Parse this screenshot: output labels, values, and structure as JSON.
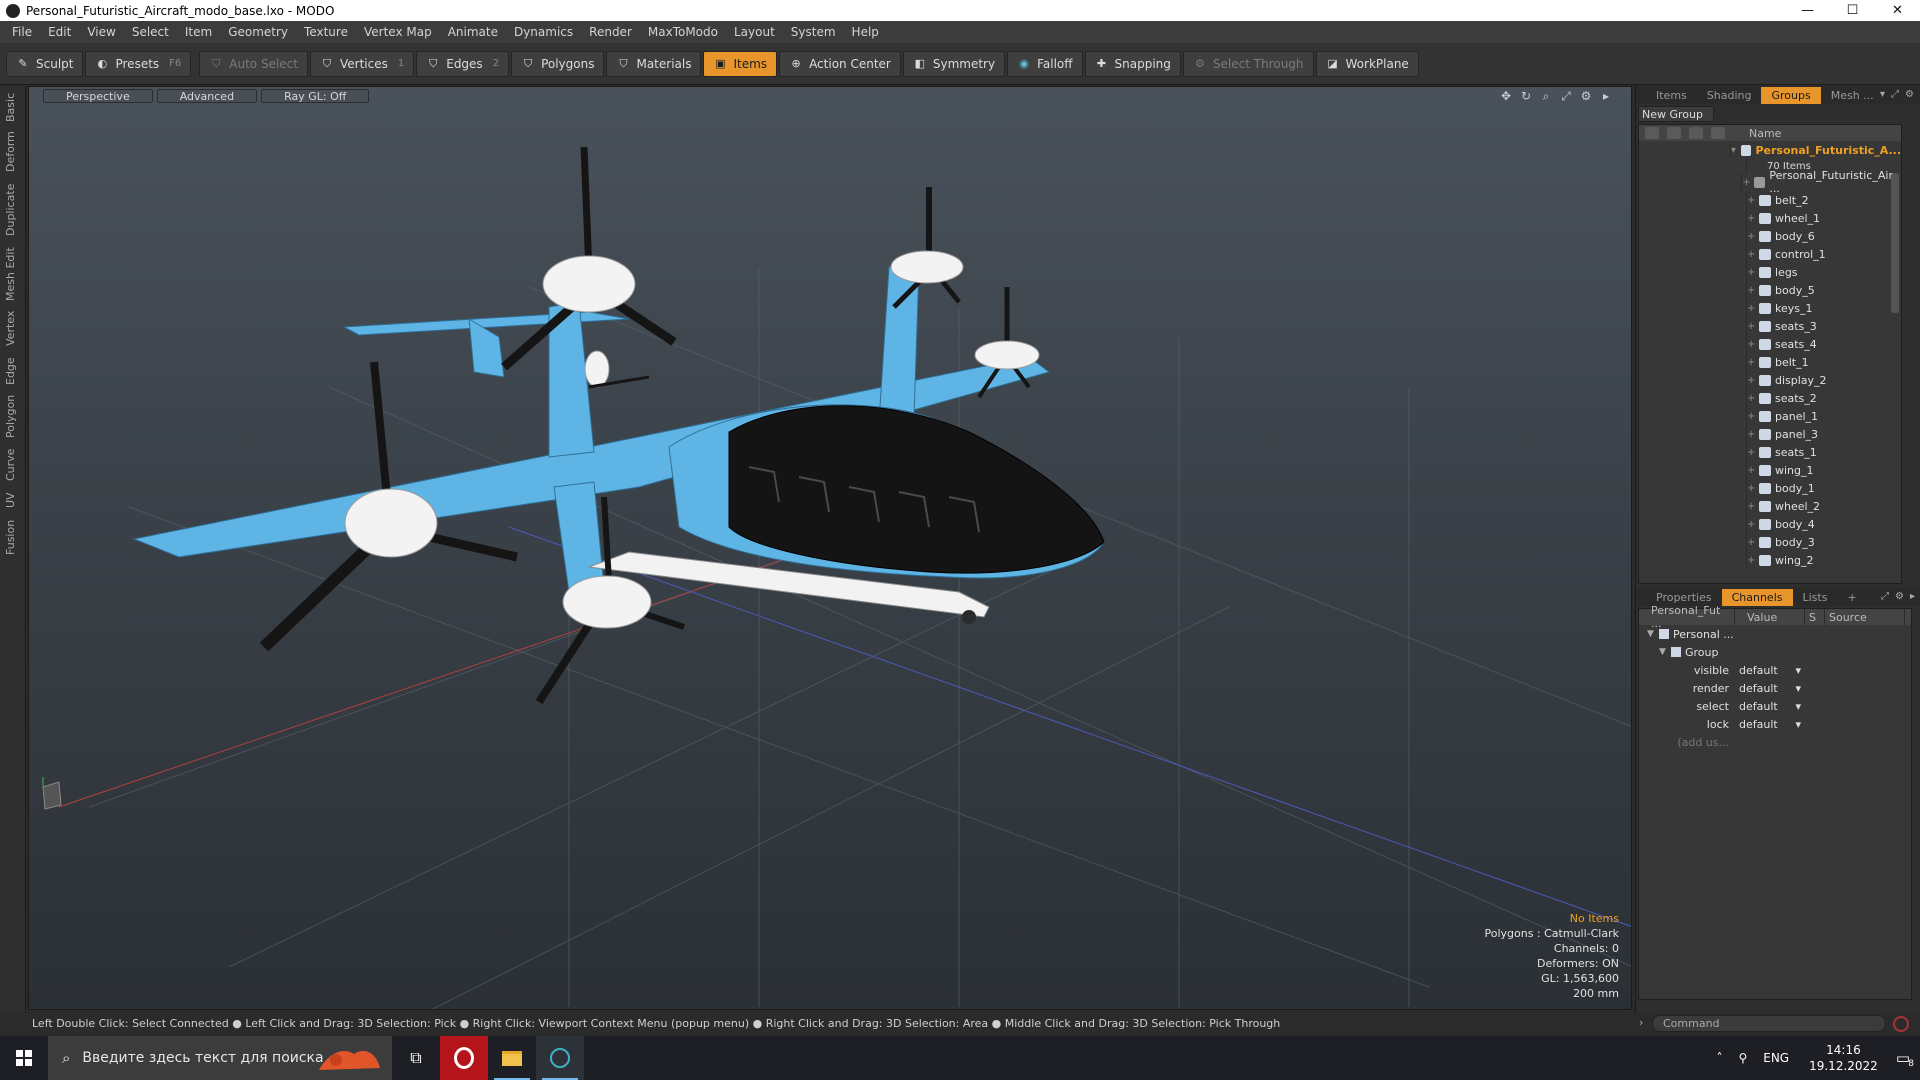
{
  "window": {
    "title": "Personal_Futuristic_Aircraft_modo_base.lxo - MODO",
    "buttons": [
      "—",
      "☐",
      "✕"
    ]
  },
  "menu": [
    "File",
    "Edit",
    "View",
    "Select",
    "Item",
    "Geometry",
    "Texture",
    "Vertex Map",
    "Animate",
    "Dynamics",
    "Render",
    "MaxToModo",
    "Layout",
    "System",
    "Help"
  ],
  "toolbar": {
    "sculpt": "Sculpt",
    "presets": "Presets",
    "presets_key": "F6",
    "auto_select": "Auto Select",
    "vertices": "Vertices",
    "vertices_key": "1",
    "edges": "Edges",
    "edges_key": "2",
    "polygons": "Polygons",
    "materials": "Materials",
    "items": "Items",
    "action_center": "Action Center",
    "symmetry": "Symmetry",
    "falloff": "Falloff",
    "snapping": "Snapping",
    "select_through": "Select Through",
    "workplane": "WorkPlane"
  },
  "left_tabs": [
    "Basic",
    "Deform",
    "Duplicate",
    "Mesh Edit",
    "Vertex",
    "Edge",
    "Polygon",
    "Curve",
    "UV",
    "Fusion"
  ],
  "viewport": {
    "tabs": [
      "Perspective",
      "Advanced",
      "Ray GL: Off"
    ],
    "info": {
      "selection": "No Items",
      "polygons": "Polygons : Catmull-Clark",
      "channels": "Channels: 0",
      "deformers": "Deformers: ON",
      "gl": "GL: 1,563,600",
      "scale": "200 mm"
    }
  },
  "right_panel": {
    "tabs": [
      "Items",
      "Shading",
      "Groups",
      "Mesh ..."
    ],
    "active_tab": "Groups",
    "new_group": "New Group",
    "name_header": "Name",
    "group_name": "Personal_Futuristic_A...",
    "group_count": "70 Items",
    "first_item": "Personal_Futuristic_Air ...",
    "items": [
      "belt_2",
      "wheel_1",
      "body_6",
      "control_1",
      "legs",
      "body_5",
      "keys_1",
      "seats_3",
      "seats_4",
      "belt_1",
      "display_2",
      "seats_2",
      "panel_1",
      "panel_3",
      "seats_1",
      "wing_1",
      "body_1",
      "wheel_2",
      "body_4",
      "body_3",
      "wing_2"
    ],
    "props_tabs": [
      "Properties",
      "Channels",
      "Lists",
      "+"
    ],
    "props_active": "Channels",
    "channels_header": [
      "Personal_Fut ...",
      "Value",
      "S",
      "Source"
    ],
    "tree_root": "Personal ...",
    "tree_group": "Group",
    "channels": [
      {
        "name": "visible",
        "value": "default"
      },
      {
        "name": "render",
        "value": "default"
      },
      {
        "name": "select",
        "value": "default"
      },
      {
        "name": "lock",
        "value": "default"
      }
    ],
    "add_user": "(add us..."
  },
  "command_placeholder": "Command",
  "status_bar": "Left Double Click: Select Connected ● Left Click and Drag: 3D Selection: Pick ● Right Click: Viewport Context Menu (popup menu) ● Right Click and Drag: 3D Selection: Area ● Middle Click and Drag: 3D Selection: Pick Through",
  "taskbar": {
    "search_placeholder": "Введите здесь текст для поиска",
    "lang": "ENG",
    "time": "14:16",
    "date": "19.12.2022",
    "notification_count": "8"
  },
  "colors": {
    "accent": "#e8962c",
    "aircraft_body": "#5fb4e6",
    "canopy": "#111111"
  }
}
